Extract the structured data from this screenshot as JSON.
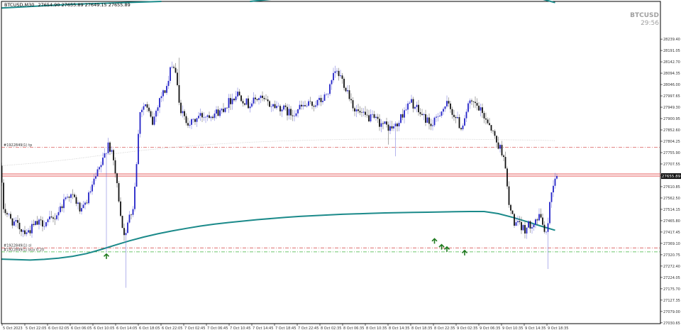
{
  "header": {
    "symbol_timeframe": "BTCUSD,M30",
    "ohlc": "27654.90 27655.89 27649.15 27655.89"
  },
  "watermark": {
    "symbol": "BTCUSD",
    "countdown": "29:56"
  },
  "price_tag": "27655.89",
  "order_labels": {
    "tp": "#1922849(1) tp",
    "sl": "#1922849(1) sl",
    "buy": "#1922849(1) buy 0.20"
  },
  "colors": {
    "background": "#ffffff",
    "bull_candle": "#2323c8",
    "bear_candle": "#111111",
    "ma_line": "#1b8a8a",
    "grey_ma": "#c8c8c8",
    "tp_sl_line": "#d23c3c",
    "entry_line": "#3cb43c",
    "price_line": "#e04040",
    "arrow": "#1f7a1f",
    "axis_text": "#333333"
  },
  "chart_data": {
    "type": "candlestick",
    "symbol": "BTCUSD",
    "timeframe": "M30",
    "ylim": [
      27027.15,
      28400
    ],
    "y_ticks": [
      "28239.40",
      "28191.05",
      "28142.70",
      "28094.35",
      "28046.00",
      "27997.65",
      "27949.30",
      "27900.95",
      "27852.60",
      "27804.25",
      "27755.90",
      "27707.55",
      "27659.20",
      "27610.85",
      "27562.50",
      "27514.15",
      "27465.80",
      "27417.45",
      "27369.10",
      "27320.75",
      "27272.40",
      "27224.05",
      "27175.70",
      "27127.35",
      "27079.00",
      "27030.65"
    ],
    "y_tick_values": [
      28239.4,
      28191.05,
      28142.7,
      28094.35,
      28046.0,
      27997.65,
      27949.3,
      27900.95,
      27852.6,
      27804.25,
      27755.9,
      27707.55,
      27659.2,
      27610.85,
      27562.5,
      27514.15,
      27465.8,
      27417.45,
      27369.1,
      27320.75,
      27272.4,
      27224.05,
      27175.7,
      27127.35,
      27079.0,
      27030.65
    ],
    "x_labels": [
      "5 Oct 2023",
      "5 Oct 22:05",
      "6 Oct 02:05",
      "6 Oct 06:05",
      "6 Oct 10:05",
      "6 Oct 14:05",
      "6 Oct 18:05",
      "6 Oct 22:05",
      "7 Oct 02:45",
      "7 Oct 06:45",
      "7 Oct 10:45",
      "7 Oct 14:45",
      "7 Oct 18:45",
      "7 Oct 22:45",
      "8 Oct 02:35",
      "8 Oct 06:35",
      "8 Oct 10:35",
      "8 Oct 14:35",
      "8 Oct 18:35",
      "8 Oct 22:35",
      "9 Oct 02:35",
      "9 Oct 06:35",
      "9 Oct 10:35",
      "9 Oct 14:35",
      "9 Oct 18:35"
    ],
    "levels": {
      "tp": 27778,
      "sl": 27350,
      "entry": 27333,
      "current": 27655.89,
      "ask": 27665
    },
    "ma_fast": {
      "name": "",
      "x_index": [
        0,
        8,
        16,
        24,
        32,
        40,
        48,
        56,
        64,
        72,
        80,
        88,
        96,
        104,
        112,
        120,
        128,
        136,
        144,
        152,
        160,
        168,
        176,
        184,
        192,
        200,
        208,
        216,
        224,
        232,
        240,
        248,
        256,
        264,
        272,
        280,
        288,
        296,
        304,
        312
      ],
      "y": [
        27302,
        27300,
        27298,
        27301,
        27306,
        27314,
        27326,
        27343,
        27362,
        27380,
        27396,
        27410,
        27422,
        27433,
        27443,
        27451,
        27458,
        27464,
        27470,
        27475,
        27480,
        27484,
        27487,
        27490,
        27493,
        27495,
        27497,
        27499,
        27500,
        27501,
        27502,
        27503,
        27504,
        27505,
        27505,
        27496,
        27480,
        27462,
        27443,
        27425
      ]
    },
    "ma_slow": {
      "name": "",
      "x_index": [
        0,
        20,
        40,
        60,
        80,
        100,
        120,
        140,
        160,
        180,
        200,
        220,
        240,
        260,
        280,
        300,
        312
      ],
      "y": [
        27700,
        27712,
        27728,
        27748,
        27766,
        27781,
        27792,
        27800,
        27806,
        27810,
        27813,
        27814,
        27814,
        27813,
        27811,
        27809,
        27807
      ]
    },
    "ma_long": {
      "name": "",
      "points": [
        [
          140,
          28400
        ],
        [
          160,
          28415
        ],
        [
          200,
          28440
        ],
        [
          240,
          28460
        ],
        [
          280,
          28450
        ],
        [
          300,
          28420
        ],
        [
          312,
          28395
        ]
      ]
    },
    "buy_arrows": [
      {
        "i": 59,
        "price": 27330
      },
      {
        "i": 244,
        "price": 27395
      },
      {
        "i": 248,
        "price": 27370
      },
      {
        "i": 251,
        "price": 27360
      },
      {
        "i": 261,
        "price": 27345
      }
    ],
    "candles": []
  }
}
